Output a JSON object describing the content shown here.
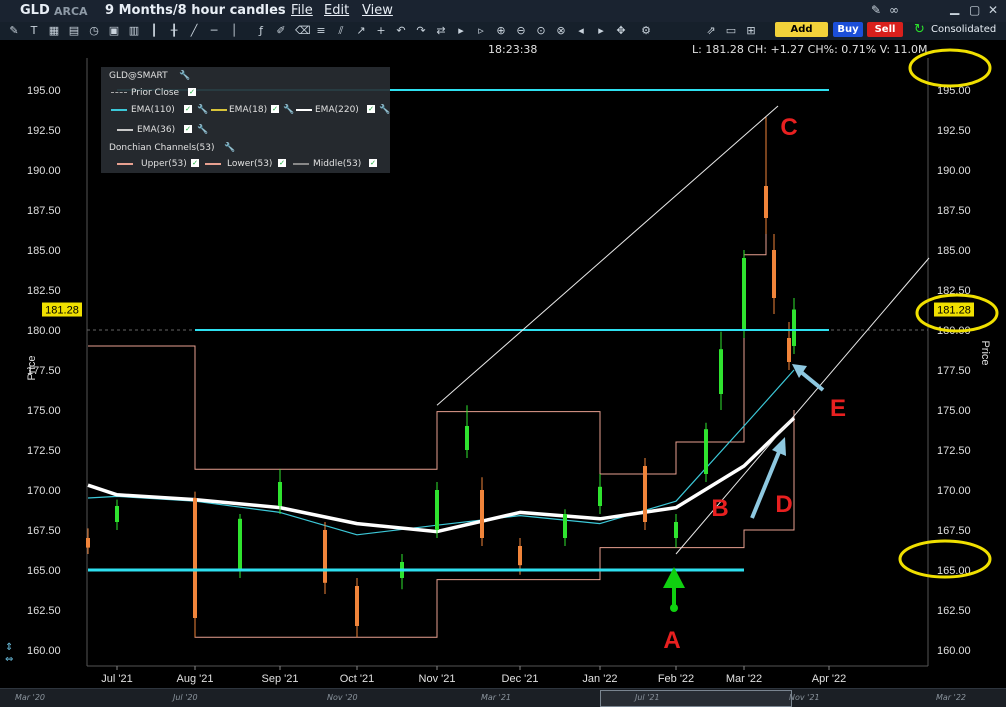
{
  "window": {
    "symbol": "GLD",
    "exchange": "ARCA",
    "period": "9 Months/8 hour candles",
    "menus": [
      "File",
      "Edit",
      "View"
    ],
    "add_alert": "Add Alert",
    "buy": "Buy",
    "sell": "Sell",
    "consolidated": "Consolidated"
  },
  "infobar": {
    "time": "18:23:38",
    "quote": "L: 181.28 CH: +1.27 CH%: 0.71% V: 11.0M"
  },
  "legend": {
    "title": "GLD@SMART",
    "prior_close": "Prior Close",
    "ema110": "EMA(110)",
    "ema18": "EMA(18)",
    "ema220": "EMA(220)",
    "ema36": "EMA(36)",
    "donchian": "Donchian Channels(53)",
    "upper": "Upper(53)",
    "lower": "Lower(53)",
    "middle": "Middle(53)"
  },
  "colors": {
    "bull": "#2fe32f",
    "bear": "#f0843a",
    "ema110": "#3cc8d8",
    "ema18": "#d8c43a",
    "ema220": "#ffffff",
    "ema36": "#c8c8c8",
    "donchian": "#e8a090",
    "middle": "#888888",
    "hline": "#2ee0f0",
    "annot": "#e82020",
    "arrow_blue": "#8ec8e0",
    "arrow_green": "#10d010",
    "circle": "#f0e000",
    "price_tag": "#f0e000"
  },
  "annotations": {
    "A": "A",
    "B": "B",
    "C": "C",
    "D": "D",
    "E": "E"
  },
  "bottom_strip": [
    "Mar '20",
    "Jul '20",
    "Nov '20",
    "Mar '21",
    "Jul '21",
    "Nov '21",
    "Mar '22"
  ],
  "chart_data": {
    "type": "candlestick",
    "ylabel": "Price",
    "ylim": [
      159.0,
      197.0
    ],
    "yticks": [
      "195.00",
      "192.50",
      "190.00",
      "187.50",
      "185.00",
      "182.50",
      "180.00",
      "177.50",
      "175.00",
      "172.50",
      "170.00",
      "167.50",
      "165.00",
      "162.50",
      "160.00"
    ],
    "xticks": [
      "Jul '21",
      "Aug '21",
      "Sep '21",
      "Oct '21",
      "Nov '21",
      "Dec '21",
      "Jan '22",
      "Feb '22",
      "Mar '22",
      "Apr '22"
    ],
    "last_price": "181.28",
    "horizontal_lines": [
      {
        "value": 195.0,
        "from": "Jul '21",
        "to": "Apr '22"
      },
      {
        "value": 180.0,
        "from": "Aug '21",
        "to": "Apr '22"
      },
      {
        "value": 165.0,
        "from": "Jun '21",
        "to": "Mar '22"
      }
    ],
    "trend_lines": [
      {
        "from": [
          "Nov '21",
          175.3
        ],
        "to": [
          "Mar '22",
          194.0
        ]
      },
      {
        "from": [
          "Feb '22",
          166.0
        ],
        "to": [
          "Apr '22",
          184.5
        ]
      }
    ],
    "ema220": [
      {
        "x": "Jun '21",
        "y": 170.3
      },
      {
        "x": "Jul '21",
        "y": 169.7
      },
      {
        "x": "Aug '21",
        "y": 169.4
      },
      {
        "x": "Sep '21",
        "y": 168.9
      },
      {
        "x": "Oct '21",
        "y": 167.9
      },
      {
        "x": "Nov '21",
        "y": 167.4
      },
      {
        "x": "Dec '21",
        "y": 168.6
      },
      {
        "x": "Jan '22",
        "y": 168.2
      },
      {
        "x": "Feb '22",
        "y": 168.9
      },
      {
        "x": "Mar '22",
        "y": 171.5
      },
      {
        "x": "Mar '22 end",
        "y": 174.5
      }
    ],
    "ema110": [
      {
        "x": "Jun '21",
        "y": 169.5
      },
      {
        "x": "Jul '21",
        "y": 169.6
      },
      {
        "x": "Aug '21",
        "y": 169.3
      },
      {
        "x": "Sep '21",
        "y": 168.6
      },
      {
        "x": "Oct '21",
        "y": 167.2
      },
      {
        "x": "Nov '21",
        "y": 167.8
      },
      {
        "x": "Dec '21",
        "y": 168.4
      },
      {
        "x": "Jan '22",
        "y": 167.9
      },
      {
        "x": "Feb '22",
        "y": 169.3
      },
      {
        "x": "Mar '22",
        "y": 174.0
      },
      {
        "x": "Mar '22 end",
        "y": 177.5
      }
    ],
    "donchian_upper": [
      {
        "x": "Jun '21",
        "y": 179.0
      },
      {
        "x": "Jul '21",
        "y": 179.0
      },
      {
        "x": "Aug '21",
        "y": 171.3
      },
      {
        "x": "Oct '21",
        "y": 171.3
      },
      {
        "x": "Nov '21",
        "y": 174.9
      },
      {
        "x": "Dec '21",
        "y": 174.9
      },
      {
        "x": "Jan '22",
        "y": 171.0
      },
      {
        "x": "Feb '22",
        "y": 173.0
      },
      {
        "x": "Mar '22",
        "y": 184.7
      },
      {
        "x": "Mar '22 peak",
        "y": 193.3
      }
    ],
    "donchian_lower": [
      {
        "x": "Jun '21",
        "y": 165.0
      },
      {
        "x": "Aug '21",
        "y": 160.8
      },
      {
        "x": "Oct '21",
        "y": 160.8
      },
      {
        "x": "Nov '21",
        "y": 164.4
      },
      {
        "x": "Jan '22",
        "y": 166.4
      },
      {
        "x": "Feb '22",
        "y": 166.4
      },
      {
        "x": "Mar '22",
        "y": 167.5
      },
      {
        "x": "Mar '22 end",
        "y": 175.0
      }
    ],
    "candles": [
      {
        "x": "Jun '21",
        "o": 167.0,
        "h": 167.6,
        "l": 166.0,
        "c": 166.4
      },
      {
        "x": "Jul '21",
        "o": 168.0,
        "h": 169.4,
        "l": 167.5,
        "c": 169.0
      },
      {
        "x": "Aug '21",
        "o": 169.5,
        "h": 169.9,
        "l": 160.8,
        "c": 162.0
      },
      {
        "x": "Aug '21 late",
        "o": 165.0,
        "h": 168.5,
        "l": 164.5,
        "c": 168.2
      },
      {
        "x": "Sep '21",
        "o": 169.0,
        "h": 171.3,
        "l": 168.5,
        "c": 170.5
      },
      {
        "x": "Sep '21 late",
        "o": 167.5,
        "h": 168.0,
        "l": 163.5,
        "c": 164.2
      },
      {
        "x": "Oct '21",
        "o": 164.0,
        "h": 164.5,
        "l": 160.8,
        "c": 161.5
      },
      {
        "x": "Oct '21 late",
        "o": 164.5,
        "h": 166.0,
        "l": 163.8,
        "c": 165.5
      },
      {
        "x": "Nov '21",
        "o": 167.5,
        "h": 170.5,
        "l": 167.0,
        "c": 170.0
      },
      {
        "x": "Nov '21 mid",
        "o": 172.5,
        "h": 175.3,
        "l": 172.0,
        "c": 174.0
      },
      {
        "x": "Nov '21 late",
        "o": 170.0,
        "h": 170.8,
        "l": 166.5,
        "c": 167.0
      },
      {
        "x": "Dec '21",
        "o": 166.5,
        "h": 167.0,
        "l": 164.7,
        "c": 165.3
      },
      {
        "x": "Dec '21 late",
        "o": 167.0,
        "h": 168.8,
        "l": 166.5,
        "c": 168.5
      },
      {
        "x": "Jan '22",
        "o": 169.0,
        "h": 171.0,
        "l": 168.5,
        "c": 170.2
      },
      {
        "x": "Jan '22 late",
        "o": 171.5,
        "h": 172.0,
        "l": 167.5,
        "c": 168.0
      },
      {
        "x": "Feb '22",
        "o": 167.0,
        "h": 168.5,
        "l": 166.4,
        "c": 168.0
      },
      {
        "x": "Feb '22 mid",
        "o": 171.0,
        "h": 174.2,
        "l": 170.5,
        "c": 173.8
      },
      {
        "x": "Feb '22 late",
        "o": 176.0,
        "h": 179.9,
        "l": 175.0,
        "c": 178.8
      },
      {
        "x": "Mar '22",
        "o": 180.0,
        "h": 185.0,
        "l": 179.5,
        "c": 184.5
      },
      {
        "x": "Mar '22 peak",
        "o": 189.0,
        "h": 193.3,
        "l": 186.0,
        "c": 187.0
      },
      {
        "x": "Mar '22 mid",
        "o": 185.0,
        "h": 186.0,
        "l": 181.0,
        "c": 182.0
      },
      {
        "x": "Mar '22 late",
        "o": 179.5,
        "h": 180.5,
        "l": 177.5,
        "c": 178.0
      },
      {
        "x": "Mar '22 end",
        "o": 179.0,
        "h": 182.0,
        "l": 178.5,
        "c": 181.28
      }
    ]
  }
}
